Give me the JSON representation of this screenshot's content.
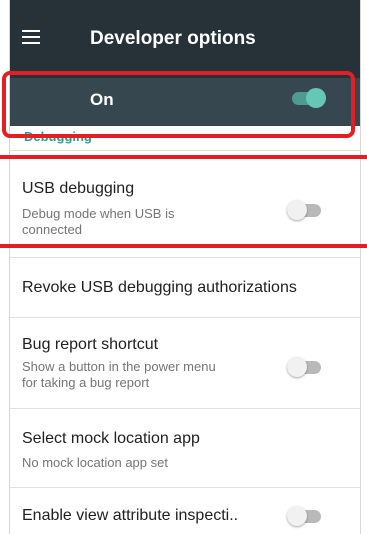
{
  "app_bar": {
    "title": "Developer options",
    "menu_icon": "hamburger-menu-icon"
  },
  "master_switch": {
    "label": "On",
    "checked": true
  },
  "section": {
    "header": "Debugging"
  },
  "preferences": [
    {
      "title": "USB debugging",
      "summary": "Debug mode when USB is connected",
      "summary_lines": [
        "Debug mode when USB is",
        "connected"
      ],
      "checked": false
    },
    {
      "title": "Revoke USB debugging authorizations"
    },
    {
      "title": "Bug report shortcut",
      "summary": "Show a button in the power menu for taking a bug report",
      "summary_lines": [
        "Show a button in the power menu",
        "for taking a bug report"
      ],
      "checked": false
    },
    {
      "title": "Select mock location app",
      "summary": "No mock location app set"
    },
    {
      "title": "Enable view attribute inspecti..",
      "checked": false
    }
  ],
  "colors": {
    "app_bar_bg": "#263238",
    "master_bar_bg": "#37474f",
    "accent": "#2a9d8f",
    "switch_on_thumb": "#66c7b6",
    "annotation": "#e31e24"
  }
}
